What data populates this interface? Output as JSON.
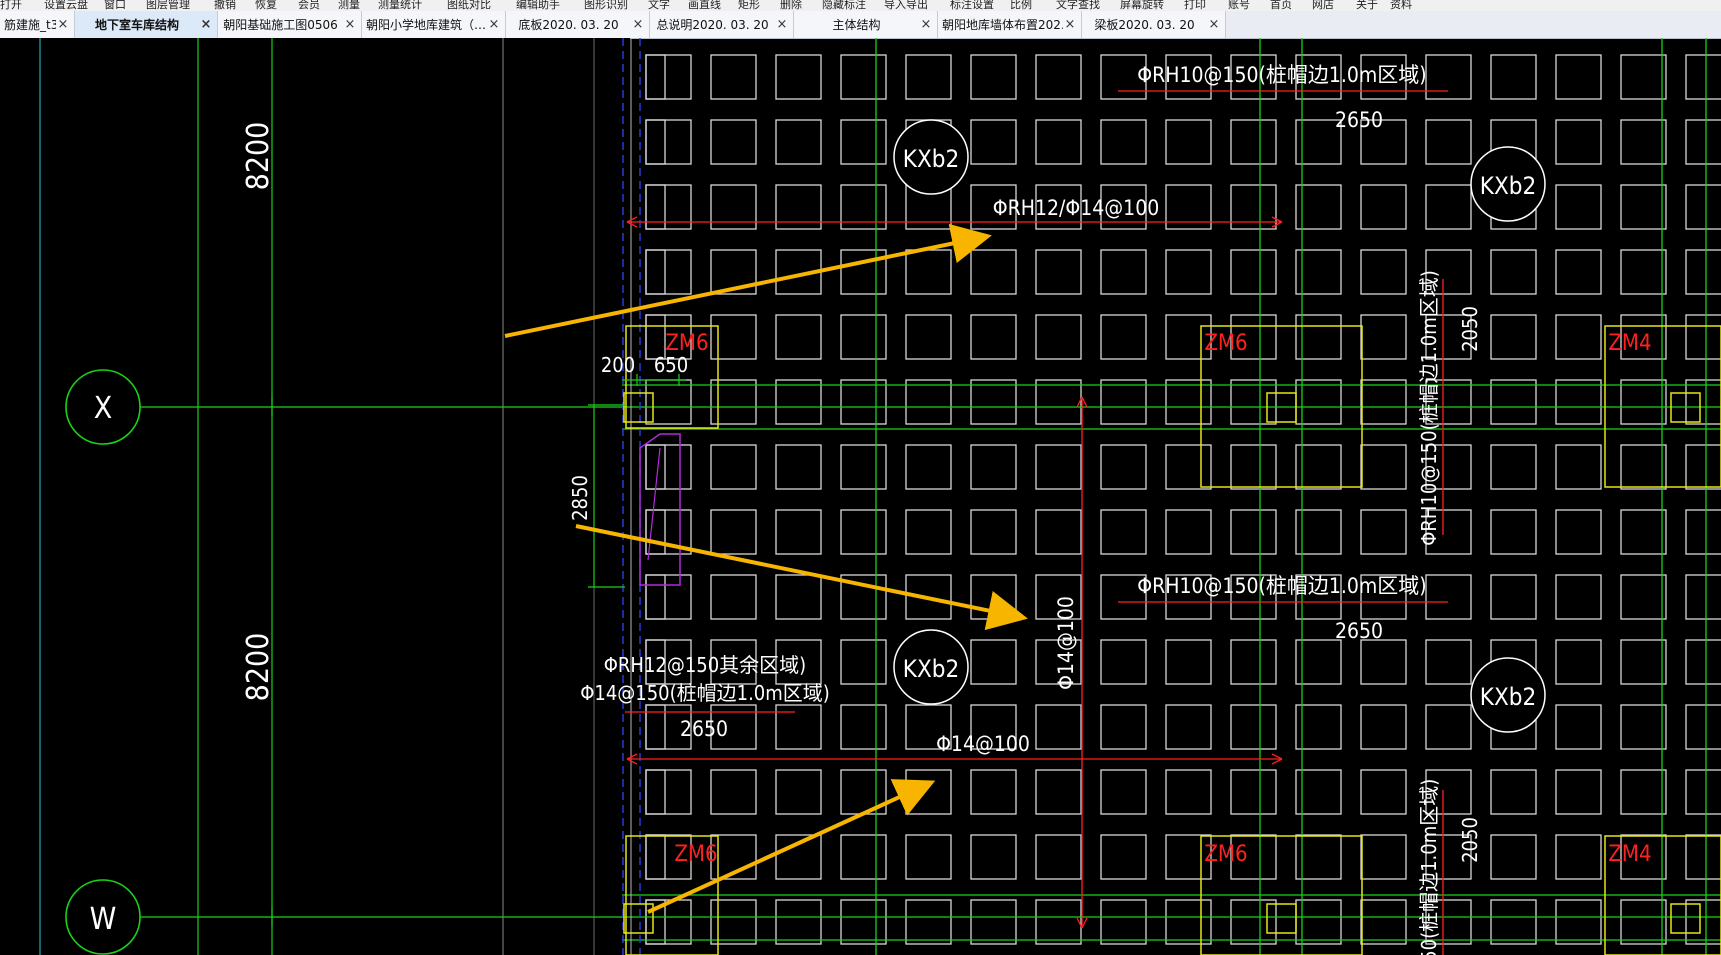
{
  "menubar": {
    "items": [
      "打开",
      "设置云盘",
      "窗口",
      "图层管理",
      "撤销",
      "恢复",
      "会员",
      "测量",
      "测量统计",
      "图纸对比",
      "编辑助手",
      "图形识别",
      "文字",
      "画直线",
      "矩形",
      "删除",
      "隐藏标注",
      "导入导出",
      "标注设置",
      "比例",
      "文字查找",
      "屏幕旋转",
      "打印",
      "账号",
      "首页",
      "网店",
      "关于",
      "资料"
    ]
  },
  "tabs": [
    {
      "label": "筋建施_t3",
      "active": false
    },
    {
      "label": "地下室车库结构",
      "active": true
    },
    {
      "label": "朝阳基础施工图0506",
      "active": false
    },
    {
      "label": "朝阳小学地库建筑（…",
      "active": false
    },
    {
      "label": "底板2020. 03. 20",
      "active": false
    },
    {
      "label": "总说明2020. 03. 20",
      "active": false
    },
    {
      "label": "主体结构",
      "active": false
    },
    {
      "label": "朝阳地库墙体布置202…",
      "active": false
    },
    {
      "label": "梁板2020. 03. 20",
      "active": false
    }
  ],
  "tab_close_glyph": "×",
  "drawing": {
    "axis_x_label": "X",
    "axis_w_label": "W",
    "dim_8200_top": "8200",
    "dim_8200_bottom": "8200",
    "dim_2850": "2850",
    "dim_200": "200",
    "dim_650": "650",
    "dim_2650_top": "2650",
    "dim_2650_mid": "2650",
    "dim_2650_left": "2650",
    "dim_2050_top": "2050",
    "dim_2050_bottom": "2050",
    "rebar_rh10_top": "ΦRH10@150(桩帽边1.0m区域)",
    "rebar_rh10_mid": "ΦRH10@150(桩帽边1.0m区域)",
    "rebar_rh12_14": "ΦRH12/Φ14@100",
    "rebar_rh12_other": "ΦRH12@150其余区域)",
    "rebar_14_150": "Φ14@150(桩帽边1.0m区域)",
    "rebar_14_100_h": "Φ14@100",
    "rebar_14_100_v": "Φ14@100",
    "rebar_rh10_vert_top": "ΦRH10@150(桩帽边1.0m区域)",
    "rebar_rh10_vert_bot": "@150(桩帽边1.0m区域)",
    "slab_kxb2": "KXb2",
    "zm6": "ZM6",
    "zm4": "ZM4",
    "colors": {
      "axis_green": "#19d219",
      "grid_white": "#d8d8d8",
      "rebar_red": "#ff2020",
      "column_yellow": "#e6e619",
      "arrow_orange": "#f7b500",
      "blue_dash": "#2b3fe0",
      "magenta": "#b02cd8",
      "cyan": "#2aa8b8"
    }
  }
}
